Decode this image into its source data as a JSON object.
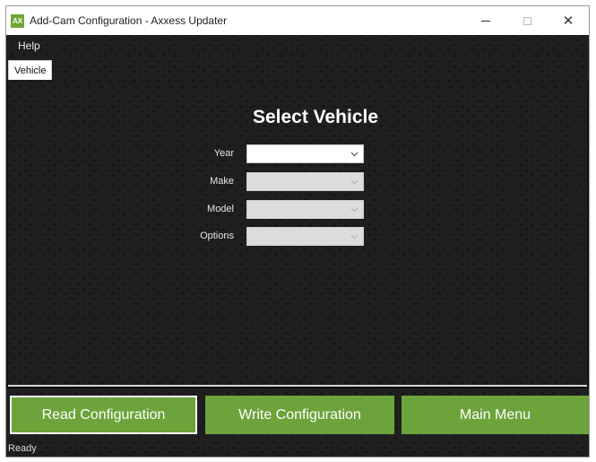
{
  "window": {
    "title": "Add-Cam Configuration - Axxess Updater",
    "icon_text": "AX",
    "controls": {
      "minimize": "—",
      "maximize": "☐",
      "close": "✕"
    }
  },
  "menu": {
    "help": "Help"
  },
  "tabs": [
    {
      "label": "Vehicle",
      "active": true
    }
  ],
  "main": {
    "heading": "Select Vehicle",
    "fields": [
      {
        "label": "Year",
        "value": "",
        "enabled": true
      },
      {
        "label": "Make",
        "value": "",
        "enabled": false
      },
      {
        "label": "Model",
        "value": "",
        "enabled": false
      },
      {
        "label": "Options",
        "value": "",
        "enabled": false
      }
    ]
  },
  "actions": {
    "read": "Read Configuration",
    "write": "Write Configuration",
    "main_menu": "Main Menu"
  },
  "status": "Ready",
  "colors": {
    "accent": "#6ca33a",
    "background": "#0c0c0c",
    "text_light": "#ffffff"
  }
}
